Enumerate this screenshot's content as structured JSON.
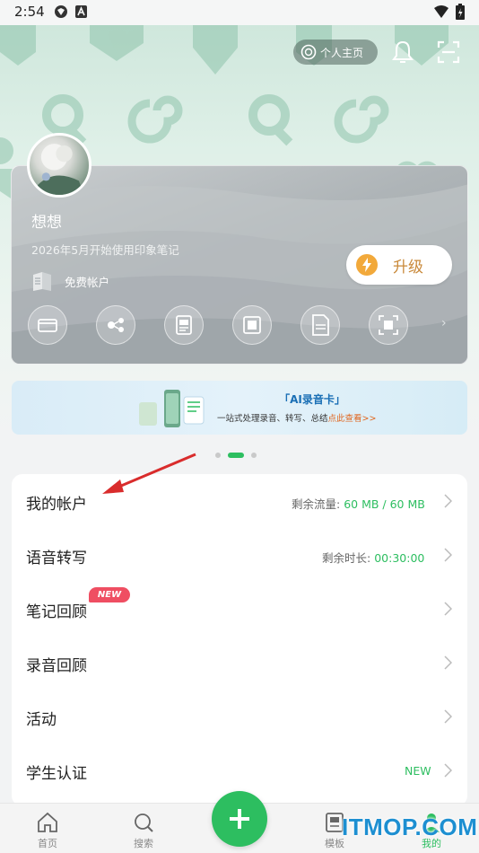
{
  "status_bar": {
    "time": "2:54"
  },
  "header": {
    "profile_button": "个人主页"
  },
  "account_card": {
    "username": "想想",
    "since": "2026年5月开始使用印象笔记",
    "account_type": "免费帐户",
    "upgrade_label": "升级"
  },
  "banner": {
    "title": "「AI录音卡」",
    "subtitle": "一站式处理录音、转写、总结",
    "link": "点此查看>>"
  },
  "menu": [
    {
      "label": "我的帐户",
      "info_label": "剩余流量:",
      "info_value": "60 MB / 60 MB"
    },
    {
      "label": "语音转写",
      "info_label": "剩余时长:",
      "info_value": "00:30:00"
    },
    {
      "label": "笔记回顾",
      "badge": "NEW"
    },
    {
      "label": "录音回顾"
    },
    {
      "label": "活动"
    },
    {
      "label": "学生认证",
      "info_value": "NEW"
    }
  ],
  "nav": {
    "home": "首页",
    "search": "搜索",
    "templates": "模板",
    "mine": "我的"
  },
  "watermark": "ITMOP.COM",
  "colors": {
    "accent": "#2dbe60",
    "badge": "#ef4e62",
    "upgrade_text": "#c9893a"
  }
}
